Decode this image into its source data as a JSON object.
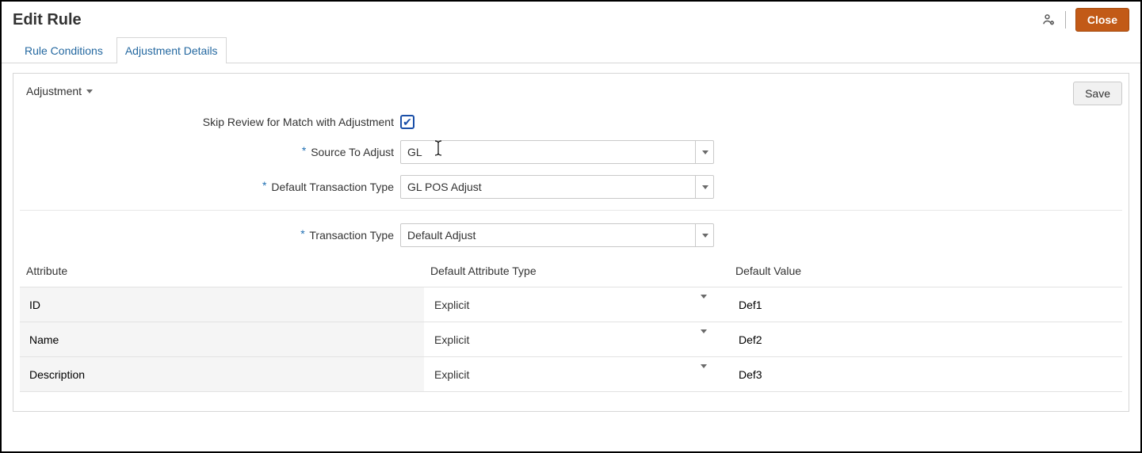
{
  "header": {
    "title": "Edit Rule",
    "close_label": "Close"
  },
  "tabs": {
    "rule_conditions": "Rule Conditions",
    "adjustment_details": "Adjustment Details"
  },
  "panel": {
    "adjustment_label": "Adjustment",
    "save_label": "Save"
  },
  "form": {
    "skip_review_label": "Skip Review for Match with Adjustment",
    "skip_review_checked": true,
    "source_label": "Source To Adjust",
    "source_value": "GL",
    "default_txn_label": "Default Transaction Type",
    "default_txn_value": "GL POS Adjust",
    "txn_label": "Transaction Type",
    "txn_value": "Default Adjust"
  },
  "table": {
    "headers": {
      "attribute": "Attribute",
      "type": "Default Attribute Type",
      "value": "Default Value"
    },
    "rows": [
      {
        "attribute": "ID",
        "type": "Explicit",
        "value": "Def1"
      },
      {
        "attribute": "Name",
        "type": "Explicit",
        "value": "Def2"
      },
      {
        "attribute": "Description",
        "type": "Explicit",
        "value": "Def3"
      }
    ]
  }
}
